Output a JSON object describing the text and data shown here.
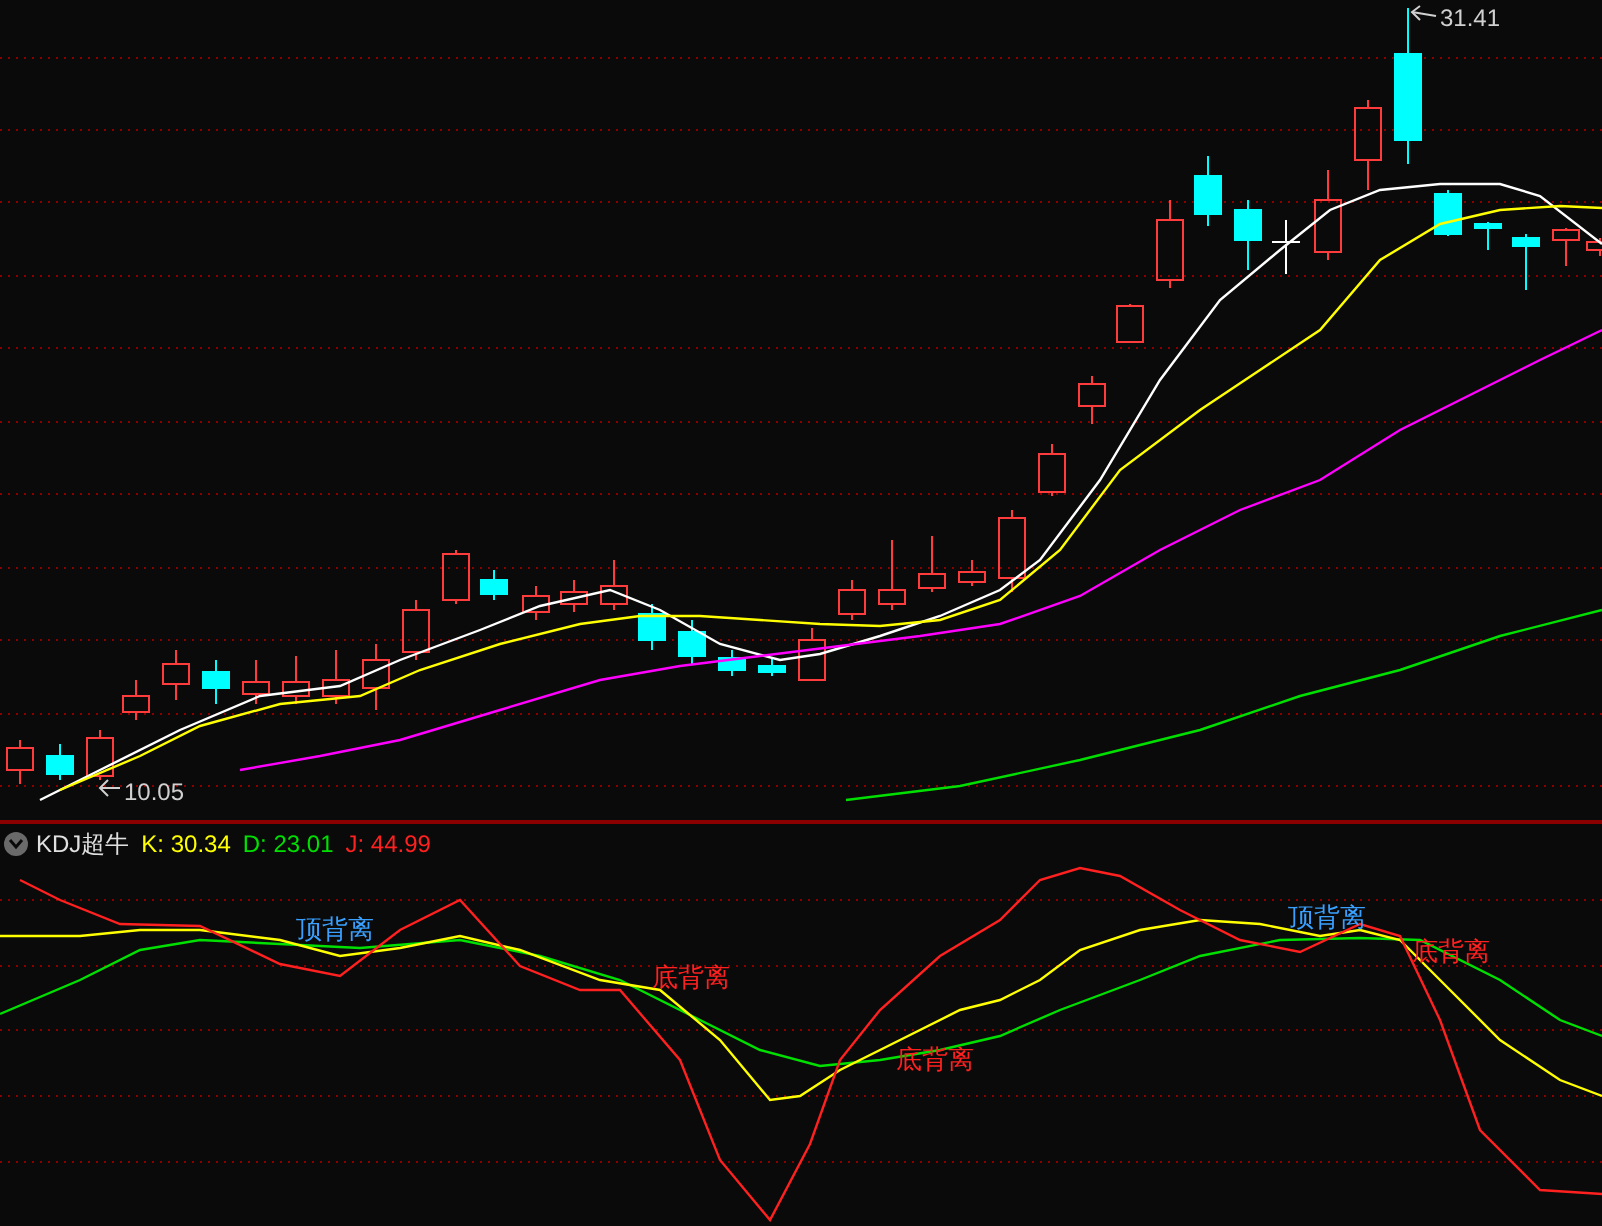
{
  "price_chart": {
    "high_label": "31.41",
    "low_label": "10.05"
  },
  "indicator": {
    "name": "KDJ超牛",
    "readings": [
      {
        "label": "K: 30.34",
        "color": "#ffff00"
      },
      {
        "label": "D: 23.01",
        "color": "#00e000"
      },
      {
        "label": "J: 44.99",
        "color": "#ff2020"
      }
    ],
    "annotations": [
      {
        "text": "顶背离",
        "kind": "top"
      },
      {
        "text": "底背离",
        "kind": "bottom"
      },
      {
        "text": "底背离",
        "kind": "bottom"
      },
      {
        "text": "顶背离",
        "kind": "top"
      },
      {
        "text": "底背离",
        "kind": "bottom"
      }
    ]
  }
}
